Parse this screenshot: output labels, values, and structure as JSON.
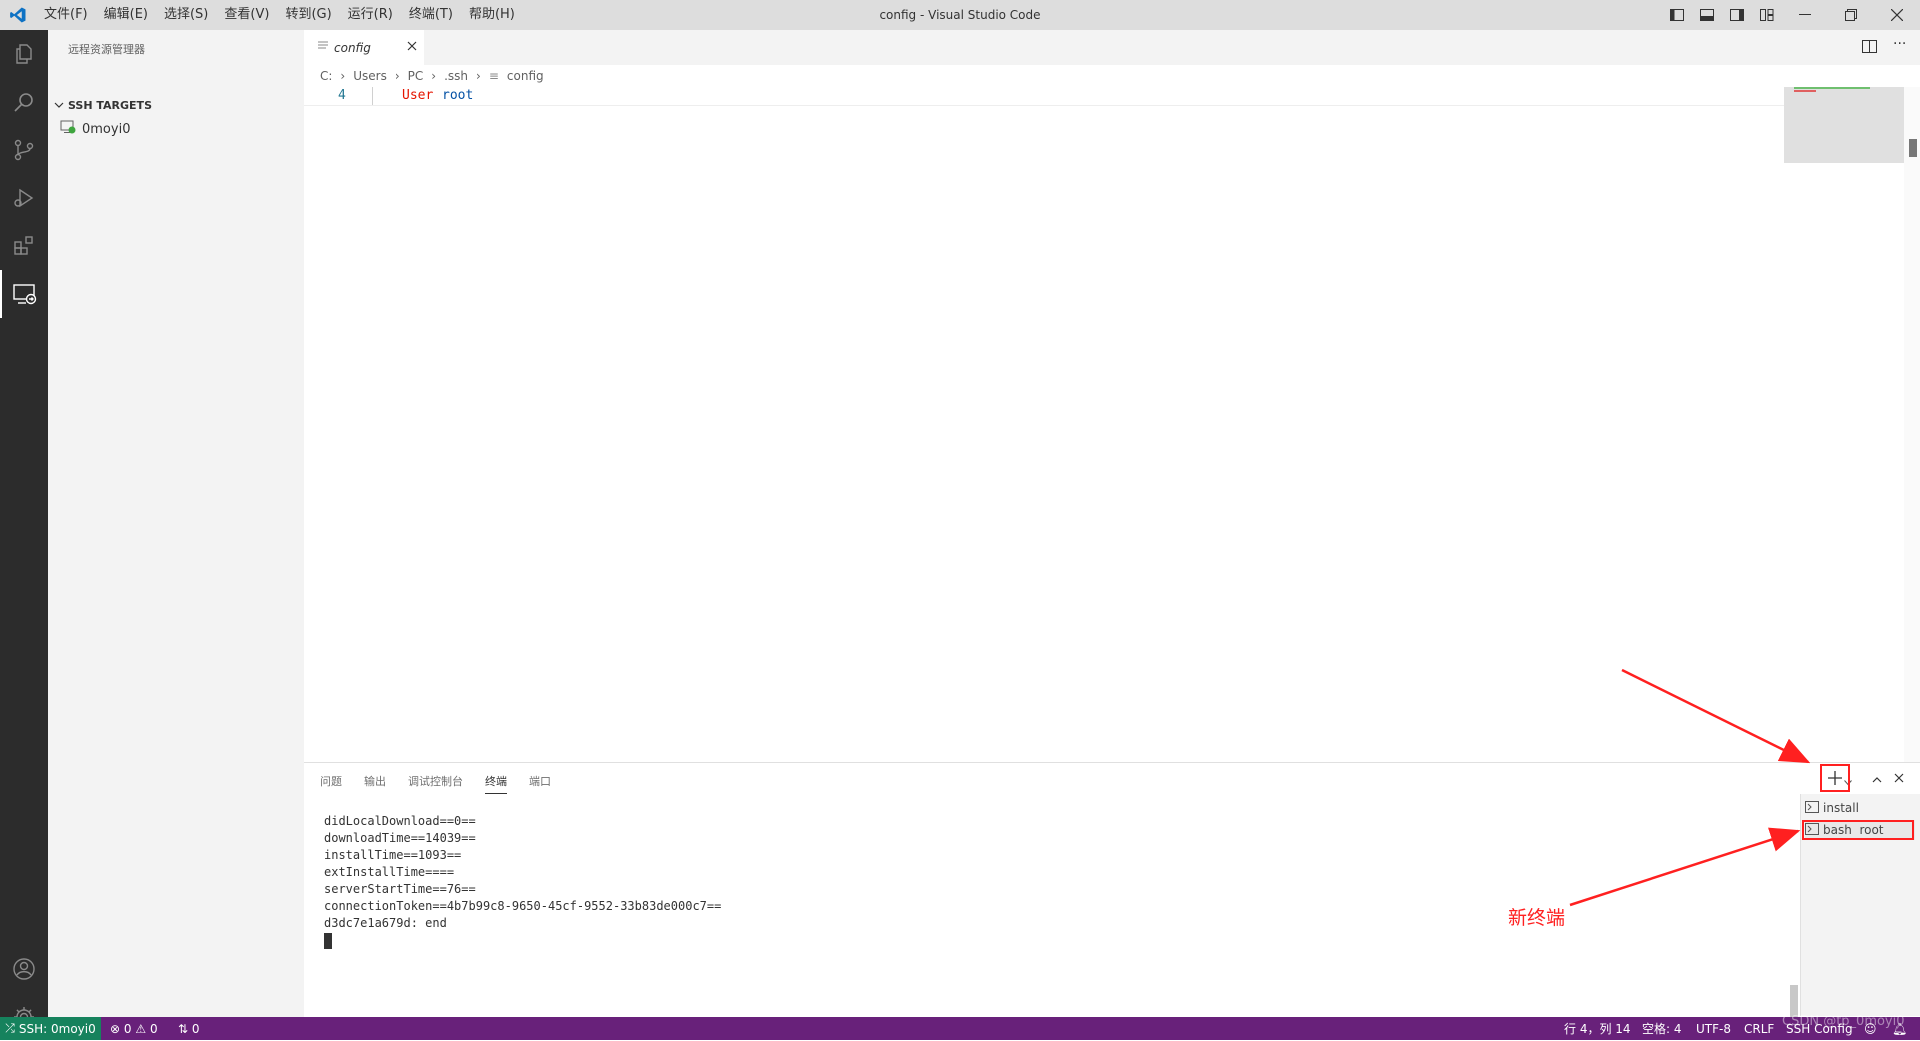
{
  "window": {
    "title": "config - Visual Studio Code"
  },
  "menu": [
    "文件(F)",
    "编辑(E)",
    "选择(S)",
    "查看(V)",
    "转到(G)",
    "运行(R)",
    "终端(T)",
    "帮助(H)"
  ],
  "sidebar": {
    "header": "远程资源管理器",
    "section": "SSH TARGETS",
    "host": "0moyi0"
  },
  "editor": {
    "tab_label": "config",
    "breadcrumb": [
      "C:",
      "Users",
      "PC",
      ".ssh",
      "config"
    ],
    "line_number": "4",
    "code_keyword": "User",
    "code_value": "root"
  },
  "panel": {
    "tabs": [
      "问题",
      "输出",
      "调试控制台",
      "终端",
      "端口"
    ],
    "active_tab": "终端",
    "terminal_lines": [
      "didLocalDownload==0==",
      "downloadTime==14039==",
      "installTime==1093==",
      "extInstallTime====",
      "serverStartTime==76==",
      "connectionToken==4b7b99c8-9650-45cf-9552-33b83de000c7==",
      "d3dc7e1a679d: end"
    ],
    "terminal_list": [
      "install",
      "bash  root"
    ]
  },
  "annotation": "新终端",
  "statusbar": {
    "remote": "SSH: 0moyi0",
    "errors": "0",
    "warnings": "0",
    "ports": "0",
    "position": "行 4，列 14",
    "spaces": "空格: 4",
    "encoding": "UTF-8",
    "eol": "CRLF",
    "language": "SSH Config"
  },
  "watermark": "CSDN @tp_0moyi0",
  "colors": {
    "statusbar": "#68217a",
    "remote": "#16825d",
    "annotation": "#ff2020"
  },
  "icons": [
    "explorer-icon",
    "search-icon",
    "source-control-icon",
    "run-debug-icon",
    "extensions-icon",
    "remote-explorer-icon",
    "account-icon",
    "manage-gear-icon"
  ]
}
